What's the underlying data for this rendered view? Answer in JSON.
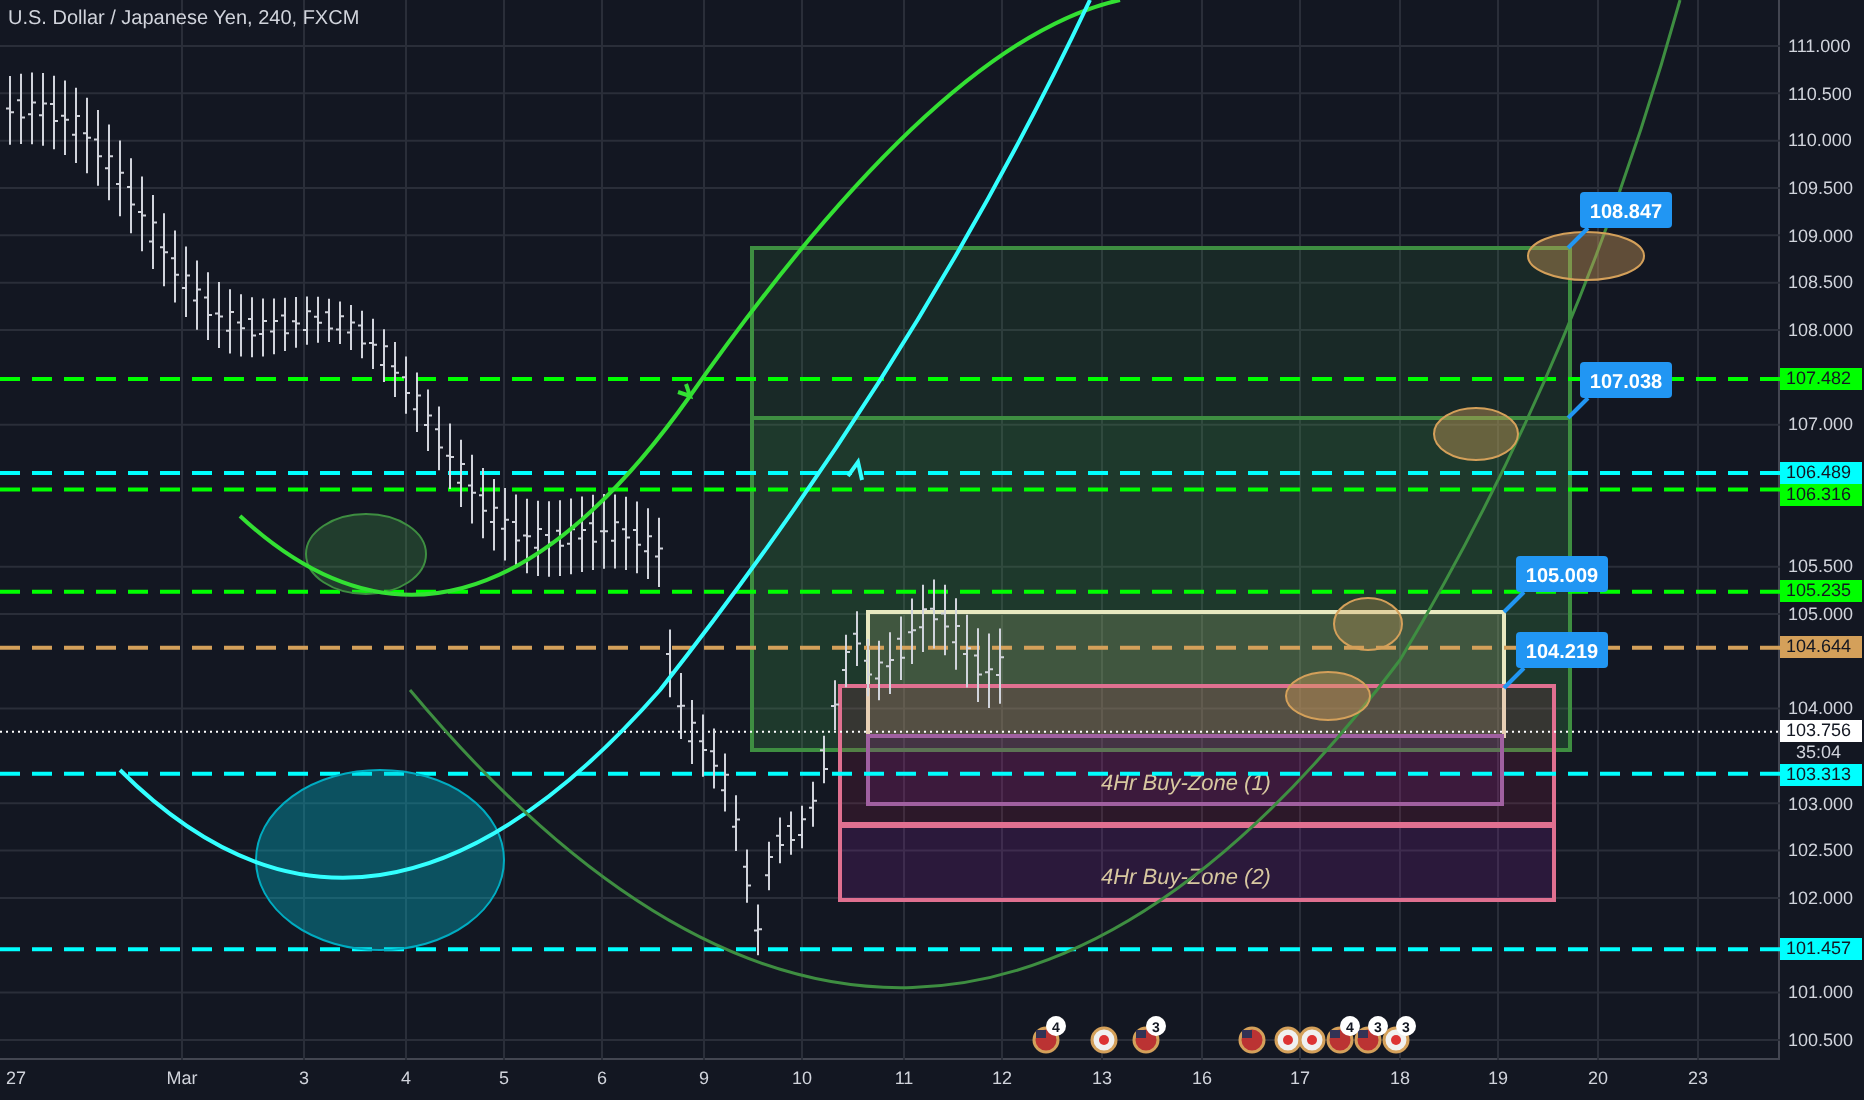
{
  "title": "U.S. Dollar / Japanese Yen, 240, FXCM",
  "price_axis": [
    "111.000",
    "110.500",
    "110.000",
    "109.500",
    "109.000",
    "108.500",
    "108.000",
    "107.000",
    "105.500",
    "105.000",
    "104.000",
    "103.000",
    "102.500",
    "102.000",
    "101.000",
    "100.500"
  ],
  "price_tags": [
    {
      "value": "107.482",
      "kind": "level",
      "color": "#00ff00"
    },
    {
      "value": "106.489",
      "kind": "level",
      "color": "#00ffff"
    },
    {
      "value": "106.316",
      "kind": "level",
      "color": "#00ff00"
    },
    {
      "value": "105.235",
      "kind": "level",
      "color": "#00ff00"
    },
    {
      "value": "104.644",
      "kind": "level",
      "color": "#d4a05a"
    },
    {
      "value": "103.756",
      "kind": "current",
      "color": "#ffffff"
    },
    {
      "value": "103.313",
      "kind": "level",
      "color": "#00ffff"
    },
    {
      "value": "101.457",
      "kind": "level",
      "color": "#00ffff"
    }
  ],
  "countdown": "35:04",
  "callouts": [
    "108.847",
    "107.038",
    "105.009",
    "104.219"
  ],
  "zones": [
    "4Hr Buy-Zone (1)",
    "4Hr Buy-Zone (2)"
  ],
  "events": [
    {
      "kind": "us",
      "badge": "4"
    },
    {
      "kind": "jp"
    },
    {
      "kind": "us",
      "badge": "3"
    },
    {
      "kind": "us"
    },
    {
      "kind": "jp"
    },
    {
      "kind": "jp"
    },
    {
      "kind": "us",
      "badge": "4"
    },
    {
      "kind": "us",
      "badge": "3"
    },
    {
      "kind": "jp",
      "badge": "3"
    }
  ],
  "time_axis": [
    "27",
    "Mar",
    "3",
    "4",
    "5",
    "6",
    "9",
    "10",
    "11",
    "12",
    "13",
    "16",
    "17",
    "18",
    "19",
    "20",
    "23"
  ]
}
